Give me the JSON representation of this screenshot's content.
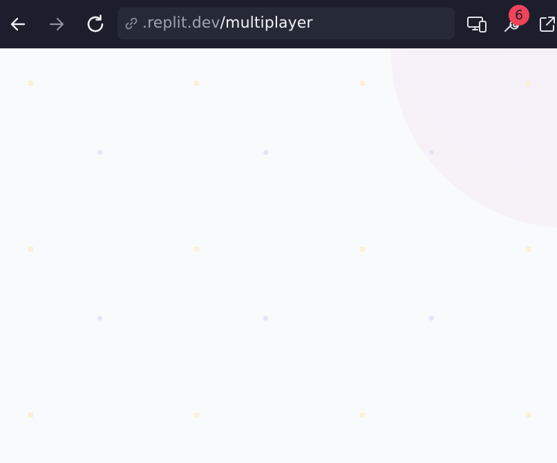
{
  "browser": {
    "url": {
      "domain": ".replit.dev",
      "path": "/multiplayer"
    },
    "notifications_count": "6"
  },
  "icons": {
    "back": "arrow-left-icon",
    "forward": "arrow-right-icon",
    "reload": "reload-icon",
    "link": "link-icon",
    "devices": "devices-icon",
    "devtools": "wrench-icon",
    "open_external": "external-link-icon"
  },
  "colors": {
    "toolbar_bg": "#1c1f2b",
    "url_bar_bg": "#262a37",
    "badge": "#f0445a",
    "page_bg": "#f9fafc"
  }
}
